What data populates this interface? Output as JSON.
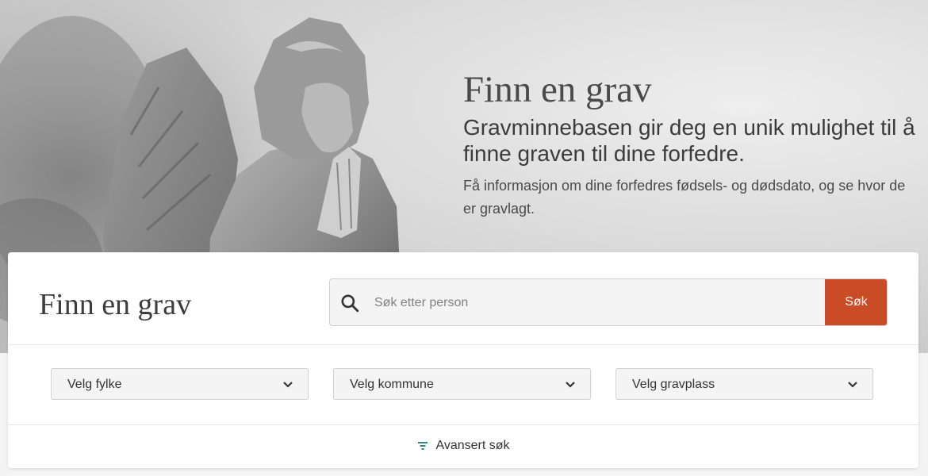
{
  "hero": {
    "title": "Finn en grav",
    "subtitle": "Gravminnebasen gir deg en unik mulighet til å finne graven til dine forfedre.",
    "description": "Få informasjon om dine forfedres fødsels- og dødsdato, og se hvor de er gravlagt."
  },
  "search_card": {
    "title": "Finn en grav",
    "search": {
      "placeholder": "Søk etter person",
      "value": "",
      "button_label": "Søk"
    },
    "filters": [
      {
        "label": "Velg fylke"
      },
      {
        "label": "Velg kommune"
      },
      {
        "label": "Velg gravplass"
      }
    ],
    "advanced_label": "Avansert søk"
  },
  "colors": {
    "accent": "#c94c26",
    "filter_icon": "#1f7a7a"
  },
  "icons": [
    "search-icon",
    "chevron-down-icon",
    "filter-icon"
  ]
}
